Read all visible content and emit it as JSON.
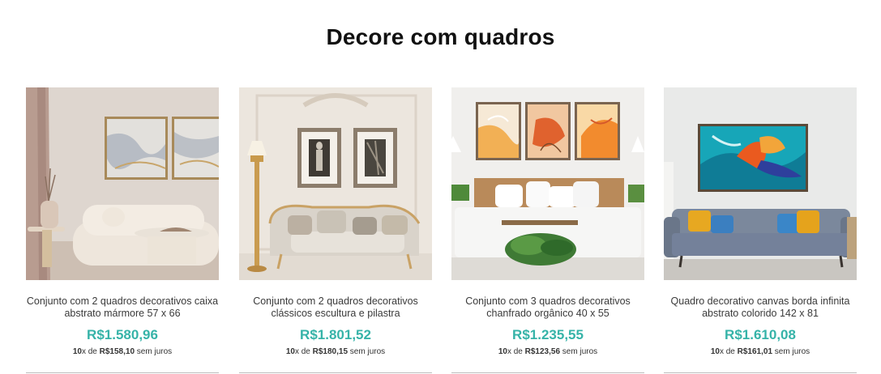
{
  "section": {
    "title": "Decore com quadros"
  },
  "installment_labels": {
    "x": "x",
    "of": "de",
    "no_interest": "sem juros"
  },
  "products": [
    {
      "name": "Conjunto com 2 quadros decorativos caixa abstrato mármore 57 x 66",
      "price": "R$1.580,96",
      "installments": "10",
      "installment_value": "R$158,10"
    },
    {
      "name": "Conjunto com 2 quadros decorativos clássicos escultura e pilastra",
      "price": "R$1.801,52",
      "installments": "10",
      "installment_value": "R$180,15"
    },
    {
      "name": "Conjunto com 3 quadros decorativos chanfrado orgânico 40 x 55",
      "price": "R$1.235,55",
      "installments": "10",
      "installment_value": "R$123,56"
    },
    {
      "name": "Quadro decorativo canvas borda infinita abstrato colorido 142 x 81",
      "price": "R$1.610,08",
      "installments": "10",
      "installment_value": "R$161,01"
    }
  ],
  "colors": {
    "price": "#36b3a8",
    "title": "#111111"
  }
}
